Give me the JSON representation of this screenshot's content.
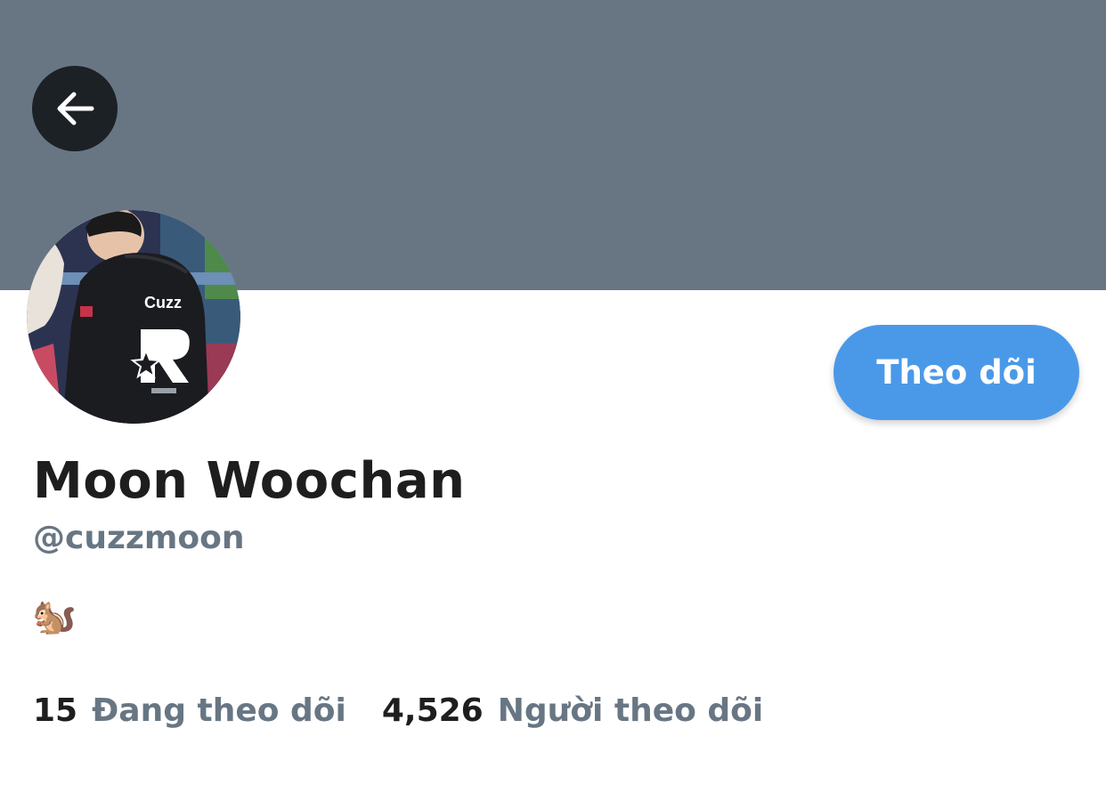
{
  "header": {
    "banner_color": "#687684",
    "back_icon": "arrow-left-icon"
  },
  "profile": {
    "avatar": {
      "jersey_text": "Cuzz",
      "logo_letter": "R"
    },
    "display_name": "Moon Woochan",
    "handle": "@cuzzmoon",
    "bio": "🐿️"
  },
  "actions": {
    "follow_label": "Theo dõi",
    "follow_color": "#4a99e9"
  },
  "stats": {
    "following_count": "15",
    "following_label": "Đang theo dõi",
    "followers_count": "4,526",
    "followers_label": "Người theo dõi"
  }
}
